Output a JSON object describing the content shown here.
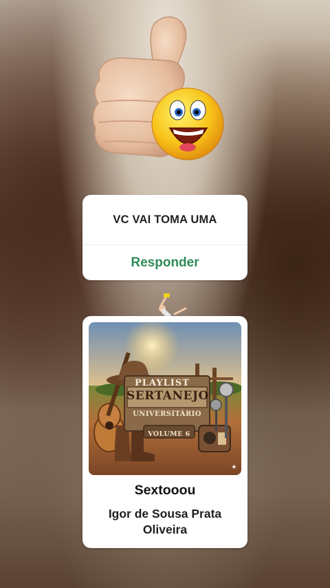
{
  "sticker": {
    "icon": "thumbs-up-smiley-icon"
  },
  "reply_card": {
    "message": "VC VAI TOMA UMA",
    "button_label": "Responder",
    "button_color": "#2e8b57"
  },
  "runner": {
    "icon": "jumping-runner-icon"
  },
  "playlist_card": {
    "cover_texts": {
      "playlist": "PLAYLIST",
      "genre": "SERTANEJO",
      "subtitle": "UNIVERSITÁRIO",
      "volume": "VOLUME 6"
    },
    "title": "Sextooou",
    "author": "Igor de Sousa Prata Oliveira"
  }
}
